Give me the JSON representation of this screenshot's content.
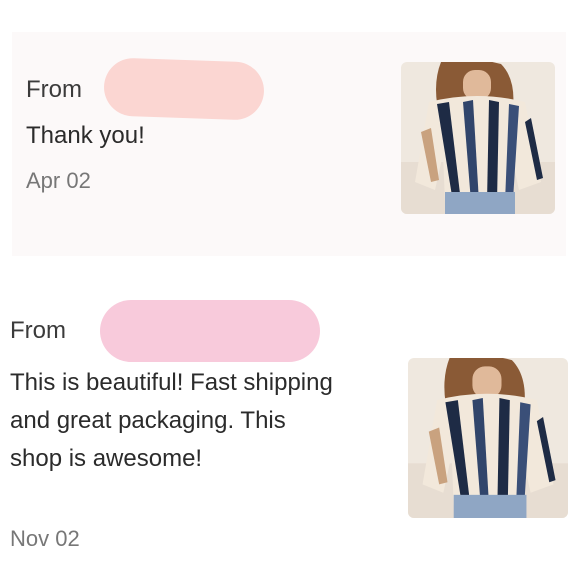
{
  "reviews": [
    {
      "from_label": "From",
      "message": "Thank you!",
      "date": "Apr 02",
      "image_alt": "blouse-photo"
    },
    {
      "from_label": "From",
      "message": "This is beautiful! Fast shipping and great packaging. This shop is awesome!",
      "date": "Nov 02",
      "image_alt": "blouse-photo"
    }
  ],
  "colors": {
    "card_background": "#fcf9f9",
    "redaction_1": "#fbd6d2",
    "redaction_2": "#f8cadb",
    "text_primary": "#2b2b2b",
    "text_secondary": "#777777"
  }
}
